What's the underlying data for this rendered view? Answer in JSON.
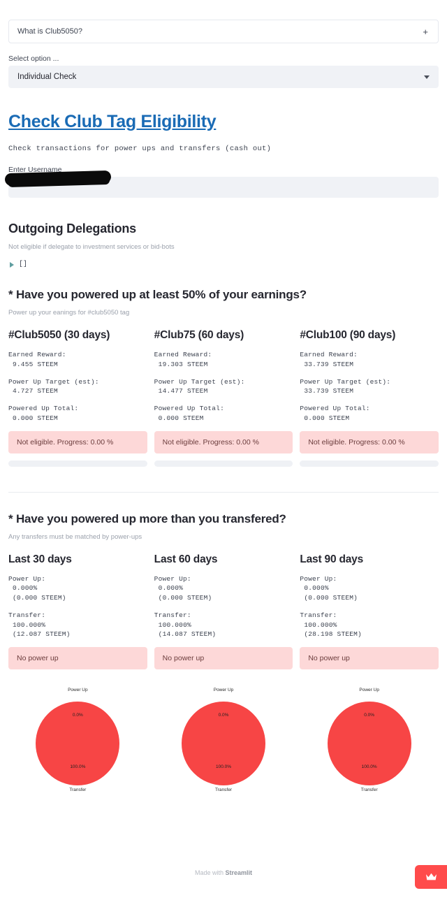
{
  "expander": {
    "label": "What is Club5050?",
    "toggle_glyph": "+"
  },
  "select": {
    "caption": "Select option ...",
    "value": "Individual Check"
  },
  "header": {
    "title": "Check Club Tag Eligibility",
    "subtitle": "Check transactions for power ups and transfers (cash out)"
  },
  "username_field": {
    "label": "Enter Username",
    "value": ""
  },
  "delegations": {
    "heading": "Outgoing Delegations",
    "note": "Not eligible if delegate to investment services or bid-bots",
    "json_value": "[]"
  },
  "question_one": {
    "heading": "* Have you powered up at least 50% of your earnings?",
    "note": "Power up your eanings for #club5050 tag",
    "columns": [
      {
        "title": "#Club5050 (30 days)",
        "earned_reward_label": "Earned Reward:",
        "earned_reward_value": "9.455 STEEM",
        "power_up_target_label": "Power Up Target (est):",
        "power_up_target_value": "4.727 STEEM",
        "powered_up_total_label": "Powered Up Total:",
        "powered_up_total_value": "0.000 STEEM",
        "alert": "Not eligible. Progress: 0.00 %",
        "progress_pct": 0
      },
      {
        "title": "#Club75 (60 days)",
        "earned_reward_label": "Earned Reward:",
        "earned_reward_value": "19.303 STEEM",
        "power_up_target_label": "Power Up Target (est):",
        "power_up_target_value": "14.477 STEEM",
        "powered_up_total_label": "Powered Up Total:",
        "powered_up_total_value": "0.000 STEEM",
        "alert": "Not eligible. Progress: 0.00 %",
        "progress_pct": 0
      },
      {
        "title": "#Club100 (90 days)",
        "earned_reward_label": "Earned Reward:",
        "earned_reward_value": "33.739 STEEM",
        "power_up_target_label": "Power Up Target (est):",
        "power_up_target_value": "33.739 STEEM",
        "powered_up_total_label": "Powered Up Total:",
        "powered_up_total_value": "0.000 STEEM",
        "alert": "Not eligible. Progress: 0.00 %",
        "progress_pct": 0
      }
    ]
  },
  "question_two": {
    "heading": "* Have you powered up more than you transfered?",
    "note": "Any transfers must be matched by power-ups",
    "columns": [
      {
        "title": "Last 30 days",
        "power_up_label": "Power Up:",
        "power_up_pct": "0.000%",
        "power_up_amount": "(0.000 STEEM)",
        "transfer_label": "Transfer:",
        "transfer_pct": "100.000%",
        "transfer_amount": "(12.087 STEEM)",
        "alert": "No power up"
      },
      {
        "title": "Last 60 days",
        "power_up_label": "Power Up:",
        "power_up_pct": "0.000%",
        "power_up_amount": "(0.000 STEEM)",
        "transfer_label": "Transfer:",
        "transfer_pct": "100.000%",
        "transfer_amount": "(14.087 STEEM)",
        "alert": "No power up"
      },
      {
        "title": "Last 90 days",
        "power_up_label": "Power Up:",
        "power_up_pct": "0.000%",
        "power_up_amount": "(0.000 STEEM)",
        "transfer_label": "Transfer:",
        "transfer_pct": "100.000%",
        "transfer_amount": "(28.198 STEEM)",
        "alert": "No power up"
      }
    ]
  },
  "chart_data": [
    {
      "type": "pie",
      "title": "",
      "labels": [
        "Power Up",
        "Transfer"
      ],
      "values": [
        0.0,
        100.0
      ],
      "data_labels": [
        "0.0%",
        "100.0%"
      ],
      "colors": [
        "#f74545",
        "#f74545"
      ],
      "legend": "none",
      "period": "Last 30 days"
    },
    {
      "type": "pie",
      "title": "",
      "labels": [
        "Power Up",
        "Transfer"
      ],
      "values": [
        0.0,
        100.0
      ],
      "data_labels": [
        "0.0%",
        "100.0%"
      ],
      "colors": [
        "#f74545",
        "#f74545"
      ],
      "legend": "none",
      "period": "Last 60 days"
    },
    {
      "type": "pie",
      "title": "",
      "labels": [
        "Power Up",
        "Transfer"
      ],
      "values": [
        0.0,
        100.0
      ],
      "data_labels": [
        "0.0%",
        "100.0%"
      ],
      "colors": [
        "#f74545",
        "#f74545"
      ],
      "legend": "none",
      "period": "Last 90 days"
    }
  ],
  "footer": {
    "made_with": "Made with ",
    "brand": "Streamlit",
    "manage_icon": "crown-icon"
  },
  "theme": {
    "accent_red": "#ff4b4b",
    "pie_red": "#f74545",
    "link_blue": "#1a6bb5",
    "alert_bg": "#fdd8d8",
    "widget_bg": "#f0f2f6"
  }
}
